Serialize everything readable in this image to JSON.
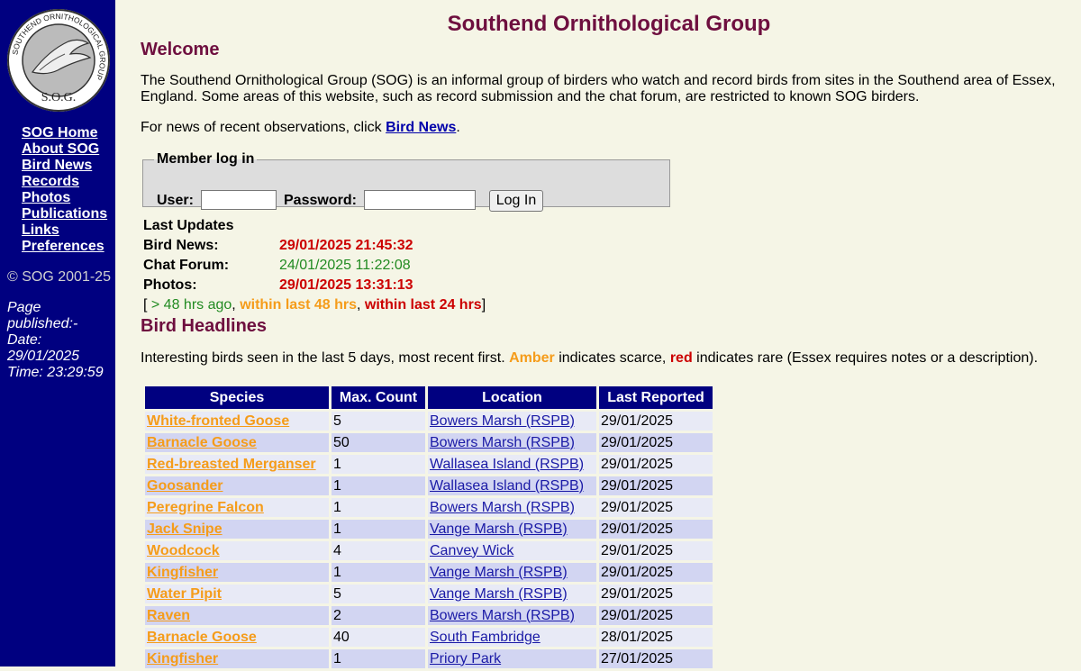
{
  "logo": {
    "ring_text": "SOUTHEND ORNITHOLOGICAL GROUP",
    "initials": "S.O.G."
  },
  "nav": [
    "SOG Home",
    "About SOG",
    "Bird News",
    "Records",
    "Photos",
    "Publications",
    "Links",
    "Preferences"
  ],
  "copyright": "© SOG 2001-25",
  "published": {
    "line1": "Page",
    "line2": "published:-",
    "line3": "Date:",
    "date": "29/01/2025",
    "time": "Time: 23:29:59"
  },
  "site_title": "Southend Ornithological Group",
  "welcome": {
    "heading": "Welcome",
    "intro": "The Southend Ornithological Group (SOG) is an informal group of birders who watch and record birds from sites in the Southend area of Essex, England. Some areas of this website, such as record submission and the chat forum, are restricted to known SOG birders.",
    "news_prefix": "For news of recent observations, click ",
    "news_link": "Bird News",
    "news_suffix": "."
  },
  "login": {
    "legend": "Member log in",
    "user_label": "User:",
    "user_value": "",
    "password_label": "Password:",
    "password_value": "",
    "button": "Log In"
  },
  "updates": {
    "title": "Last Updates",
    "rows": [
      {
        "label": "Bird News:",
        "value": "29/01/2025 21:45:32",
        "status": "red"
      },
      {
        "label": "Chat Forum:",
        "value": "24/01/2025 11:22:08",
        "status": "green"
      },
      {
        "label": "Photos:",
        "value": "29/01/2025 13:31:13",
        "status": "red"
      }
    ],
    "legend": {
      "open": "[ ",
      "green": "> 48 hrs ago",
      "sep1": ", ",
      "amber": "within last 48 hrs",
      "sep2": ", ",
      "red": "within last 24 hrs",
      "close": "]"
    }
  },
  "headlines": {
    "heading": "Bird Headlines",
    "intro_prefix": "Interesting birds seen in the last 5 days, most recent first. ",
    "amber_word": "Amber",
    "mid": " indicates scarce, ",
    "red_word": "red",
    "suffix": " indicates rare (Essex requires notes or a description).",
    "columns": [
      "Species",
      "Max. Count",
      "Location",
      "Last Reported"
    ],
    "rows": [
      {
        "species": "White-fronted Goose",
        "count": "5",
        "location": "Bowers Marsh (RSPB)",
        "date": "29/01/2025"
      },
      {
        "species": "Barnacle Goose",
        "count": "50",
        "location": "Bowers Marsh (RSPB)",
        "date": "29/01/2025"
      },
      {
        "species": "Red-breasted Merganser",
        "count": "1",
        "location": "Wallasea Island (RSPB)",
        "date": "29/01/2025"
      },
      {
        "species": "Goosander",
        "count": "1",
        "location": "Wallasea Island (RSPB)",
        "date": "29/01/2025"
      },
      {
        "species": "Peregrine Falcon",
        "count": "1",
        "location": "Bowers Marsh (RSPB)",
        "date": "29/01/2025"
      },
      {
        "species": "Jack Snipe",
        "count": "1",
        "location": "Vange Marsh (RSPB)",
        "date": "29/01/2025"
      },
      {
        "species": "Woodcock",
        "count": "4",
        "location": "Canvey Wick",
        "date": "29/01/2025"
      },
      {
        "species": "Kingfisher",
        "count": "1",
        "location": "Vange Marsh (RSPB)",
        "date": "29/01/2025"
      },
      {
        "species": "Water Pipit",
        "count": "5",
        "location": "Vange Marsh (RSPB)",
        "date": "29/01/2025"
      },
      {
        "species": "Raven",
        "count": "2",
        "location": "Bowers Marsh (RSPB)",
        "date": "29/01/2025"
      },
      {
        "species": "Barnacle Goose",
        "count": "40",
        "location": "South Fambridge",
        "date": "28/01/2025"
      },
      {
        "species": "Kingfisher",
        "count": "1",
        "location": "Priory Park",
        "date": "27/01/2025"
      }
    ]
  },
  "colors": {
    "sidebar": "#000080",
    "title": "#6e0f3f",
    "red": "#cc0000",
    "green": "#228b22",
    "amber": "#f59c1a"
  }
}
